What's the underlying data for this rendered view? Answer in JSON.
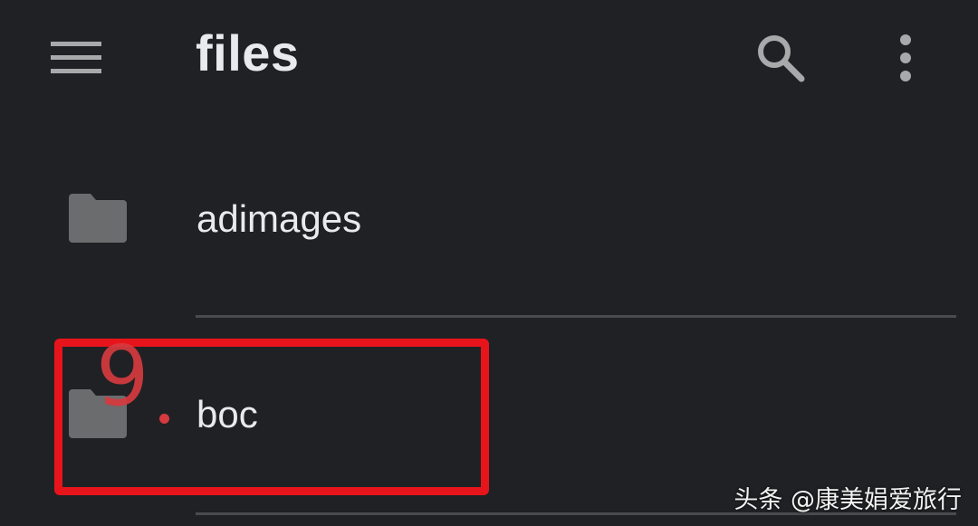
{
  "toolbar": {
    "menu_icon": "hamburger-menu-icon",
    "title": "files",
    "search_icon": "search-icon",
    "more_icon": "more-vert-icon"
  },
  "items": [
    {
      "label": "adimages",
      "icon": "folder-icon"
    },
    {
      "label": "boc",
      "icon": "folder-icon"
    }
  ],
  "annotation": {
    "number": "9",
    "color": "#e8141b"
  },
  "watermark": {
    "text": "头条 @康美娟爱旅行"
  },
  "colors": {
    "background": "#202124",
    "text": "#e8eaed",
    "icon": "#6b6c6e",
    "divider": "#4a4b4e"
  }
}
